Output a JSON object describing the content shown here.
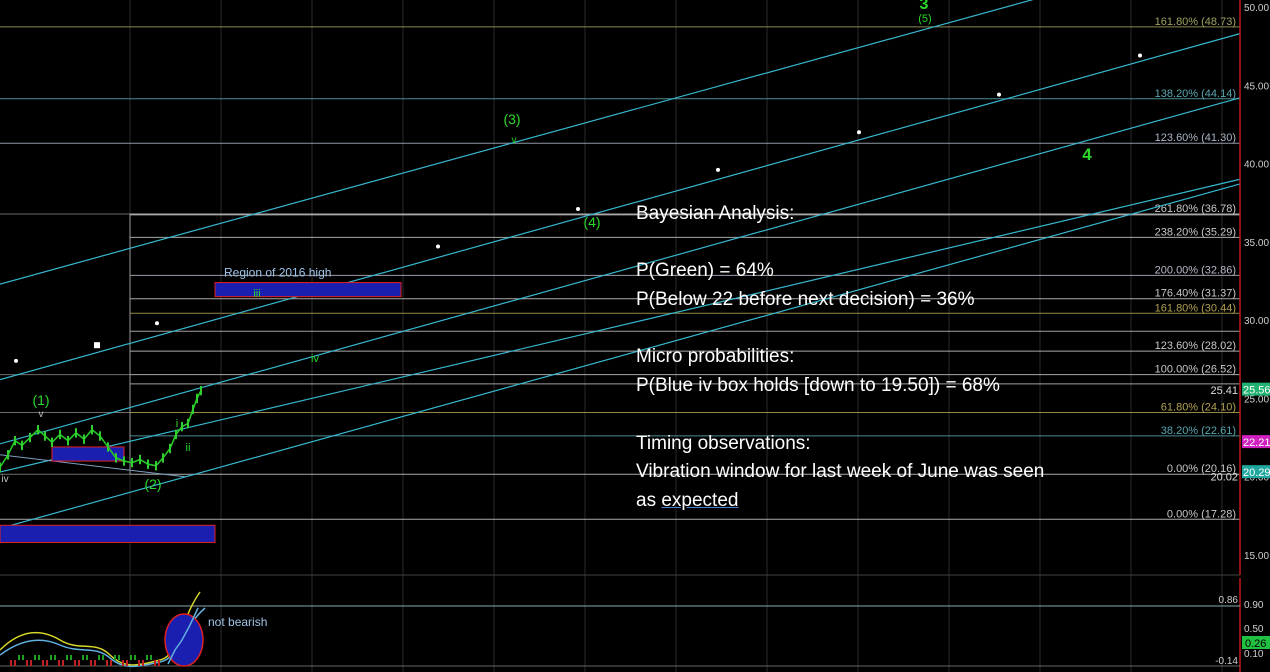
{
  "analysis": {
    "title": "Bayesian Analysis:",
    "p_green": "P(Green) = 64%",
    "p_below": "P(Below 22 before next decision) = 36%",
    "micro_title": "Micro probabilities:",
    "p_blue": "P(Blue iv box holds [down to 19.50]) = 68%",
    "timing_title": "Timing observations:",
    "timing_line1": "Vibration window for last week of June was seen",
    "timing_line2a": "as ",
    "timing_line2b": "expected"
  },
  "region_label": "Region of 2016 high",
  "indicator_label": "not bearish",
  "chart_data": {
    "type": "line",
    "price_axis": {
      "min": 15,
      "max": 50,
      "ticks": [
        "50.00",
        "45.00",
        "40.00",
        "35.00",
        "30.00",
        "25.00",
        "20.00",
        "15.00"
      ]
    },
    "indicator_axis": {
      "ticks": [
        "0.90",
        "0.50",
        "0.10"
      ]
    },
    "fib_levels": [
      {
        "label": "161.80% (48.73)",
        "value": 48.73,
        "color": "#a0a060"
      },
      {
        "label": "138.20% (44.14)",
        "value": 44.14,
        "color": "#5aa6b0"
      },
      {
        "label": "123.60% (41.30)",
        "value": 41.3,
        "color": "#a9b4c4"
      },
      {
        "label": "261.80% (36.78)",
        "value": 36.78,
        "color": "#c8c8c8"
      },
      {
        "label": "238.20% (35.29)",
        "value": 35.29,
        "color": "#c8c8c8"
      },
      {
        "label": "200.00% (32.86)",
        "value": 32.86,
        "color": "#b8b8c8"
      },
      {
        "label": "176.40% (31.37)",
        "value": 31.37,
        "color": "#c8c8c8"
      },
      {
        "label": "161.80% (30.44)",
        "value": 30.44,
        "color": "#b0a050"
      },
      {
        "label": "123.60% (28.02)",
        "value": 28.02,
        "color": "#c8c8c8"
      },
      {
        "label": "100.00% (26.52)",
        "value": 26.52,
        "color": "#c8c8c8"
      },
      {
        "label": "61.80% (24.10)",
        "value": 24.1,
        "color": "#b0a050"
      },
      {
        "label": "38.20% (22.61)",
        "value": 22.61,
        "color": "#5aa6b0"
      },
      {
        "label": "0.00% (20.16)",
        "value": 20.16,
        "color": "#c8c8c8"
      },
      {
        "label": "0.00% (17.28)",
        "value": 17.28,
        "color": "#c8c8c8"
      }
    ],
    "price_tags": [
      {
        "label": "25.56",
        "value": 25.56,
        "bg": "#20b070"
      },
      {
        "label": "22.21",
        "value": 22.21,
        "bg": "#d020c0"
      },
      {
        "label": "20.29",
        "value": 20.29,
        "bg": "#20a8a0"
      }
    ],
    "annotations": {
      "level_25_41": "25.41",
      "level_20_02": "20.02",
      "indicator_top": "0.86",
      "indicator_bottom": "-0.14",
      "indicator_green": "0.26"
    },
    "wave_labels": [
      {
        "text": "3",
        "color": "#2bd92b",
        "bold": true
      },
      {
        "text": "(5)",
        "color": "#2bd92b"
      },
      {
        "text": "(3)",
        "color": "#2bd92b"
      },
      {
        "text": "v",
        "color": "#2bd92b"
      },
      {
        "text": "4",
        "color": "#2bd92b",
        "bold": true
      },
      {
        "text": "(4)",
        "color": "#2bd92b"
      },
      {
        "text": "iii",
        "color": "#2bd92b"
      },
      {
        "text": "iv",
        "color": "#2bd92b"
      },
      {
        "text": "(1)",
        "color": "#2bd92b"
      },
      {
        "text": "v",
        "color": "#c0c0c0"
      },
      {
        "text": "i",
        "color": "#2bd92b"
      },
      {
        "text": "ii",
        "color": "#2bd92b"
      },
      {
        "text": "(2)",
        "color": "#2bd92b"
      },
      {
        "text": "iv",
        "color": "#c0c0c0"
      }
    ]
  }
}
